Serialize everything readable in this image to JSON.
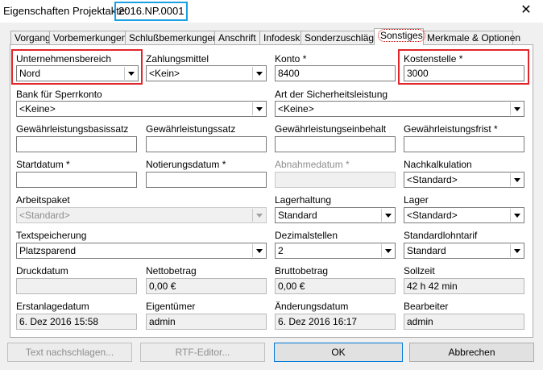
{
  "window": {
    "title": "Eigenschaften Projektakte:",
    "project_id": "2016.NP.0001",
    "close": "✕"
  },
  "tabs": [
    "Vorgang",
    "Vorbemerkungen",
    "Schlußbemerkungen",
    "Anschrift",
    "Infodesk",
    "Sonderzuschläge",
    "Sonstiges",
    "Merkmale & Optionen"
  ],
  "active_tab": "Sonstiges",
  "fields": {
    "unternehmensbereich": {
      "label": "Unternehmensbereich",
      "value": "Nord"
    },
    "zahlungsmittel": {
      "label": "Zahlungsmittel",
      "value": "<Kein>"
    },
    "konto": {
      "label": "Konto *",
      "value": "8400"
    },
    "kostenstelle": {
      "label": "Kostenstelle *",
      "value": "3000"
    },
    "bank_sperrkonto": {
      "label": "Bank für Sperrkonto",
      "value": "<Keine>"
    },
    "art_sicherheitsleistung": {
      "label": "Art der Sicherheitsleistung",
      "value": "<Keine>"
    },
    "gewaehrleistungsbasissatz": {
      "label": "Gewährleistungsbasissatz",
      "value": ""
    },
    "gewaehrleistungssatz": {
      "label": "Gewährleistungssatz",
      "value": ""
    },
    "gewaehrleistungseinbehalt": {
      "label": "Gewährleistungseinbehalt",
      "value": ""
    },
    "gewaehrleistungsfrist": {
      "label": "Gewährleistungsfrist *",
      "value": ""
    },
    "startdatum": {
      "label": "Startdatum *",
      "value": ""
    },
    "notierungsdatum": {
      "label": "Notierungsdatum *",
      "value": ""
    },
    "abnahmedatum": {
      "label": "Abnahmedatum *",
      "value": ""
    },
    "nachkalkulation": {
      "label": "Nachkalkulation",
      "value": "<Standard>"
    },
    "arbeitspaket": {
      "label": "Arbeitspaket",
      "value": "<Standard>"
    },
    "lagerhaltung": {
      "label": "Lagerhaltung",
      "value": "Standard"
    },
    "lager": {
      "label": "Lager",
      "value": "<Standard>"
    },
    "textspeicherung": {
      "label": "Textspeicherung",
      "value": "Platzsparend"
    },
    "dezimalstellen": {
      "label": "Dezimalstellen",
      "value": "2"
    },
    "standardlohntarif": {
      "label": "Standardlohntarif",
      "value": "Standard"
    },
    "druckdatum": {
      "label": "Druckdatum",
      "value": ""
    },
    "nettobetrag": {
      "label": "Nettobetrag",
      "value": "0,00 €"
    },
    "bruttobetrag": {
      "label": "Bruttobetrag",
      "value": "0,00 €"
    },
    "sollzeit": {
      "label": "Sollzeit",
      "value": "42 h 42 min"
    },
    "erstanlagedatum": {
      "label": "Erstanlagedatum",
      "value": "6. Dez 2016 15:58"
    },
    "eigentuemer": {
      "label": "Eigentümer",
      "value": "admin"
    },
    "aenderungsdatum": {
      "label": "Änderungsdatum",
      "value": "6. Dez 2016 16:17"
    },
    "bearbeiter": {
      "label": "Bearbeiter",
      "value": "admin"
    }
  },
  "buttons": {
    "text_nachschlagen": "Text nachschlagen...",
    "rtf_editor": "RTF-Editor...",
    "ok": "OK",
    "abbrechen": "Abbrechen"
  }
}
